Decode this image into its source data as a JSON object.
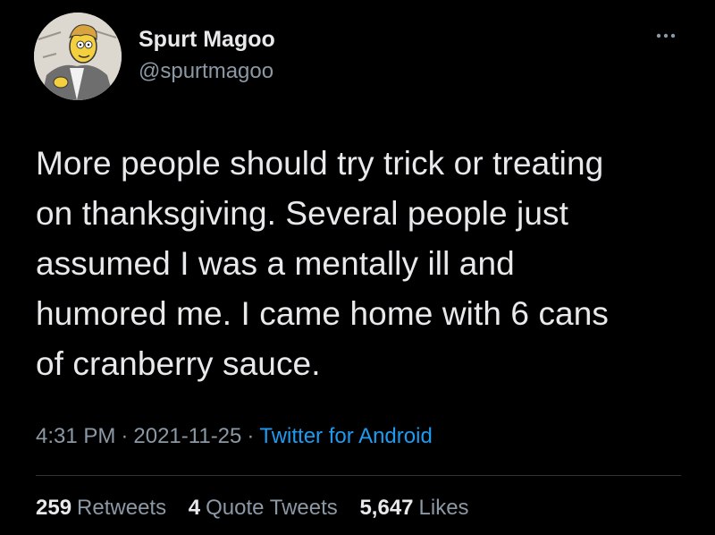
{
  "author": {
    "display_name": "Spurt Magoo",
    "handle": "@spurtmagoo",
    "avatar_icon": "cartoon-avatar-icon"
  },
  "menu": {
    "icon": "more-options-icon"
  },
  "tweet": {
    "text": "More people should try trick or treating\non thanksgiving. Several people just\nassumed I was a mentally ill and\nhumored me. I came home with 6 cans\nof cranberry sauce."
  },
  "meta": {
    "time": "4:31 PM",
    "separator": "·",
    "date": "2021-11-25",
    "source": "Twitter for Android"
  },
  "stats": {
    "retweets_count": "259",
    "retweets_label": "Retweets",
    "quotes_count": "4",
    "quotes_label": "Quote Tweets",
    "likes_count": "5,647",
    "likes_label": "Likes"
  },
  "colors": {
    "background": "#000000",
    "text": "#e7e9ea",
    "secondary": "#8b98a5",
    "link": "#1d9bf0"
  }
}
